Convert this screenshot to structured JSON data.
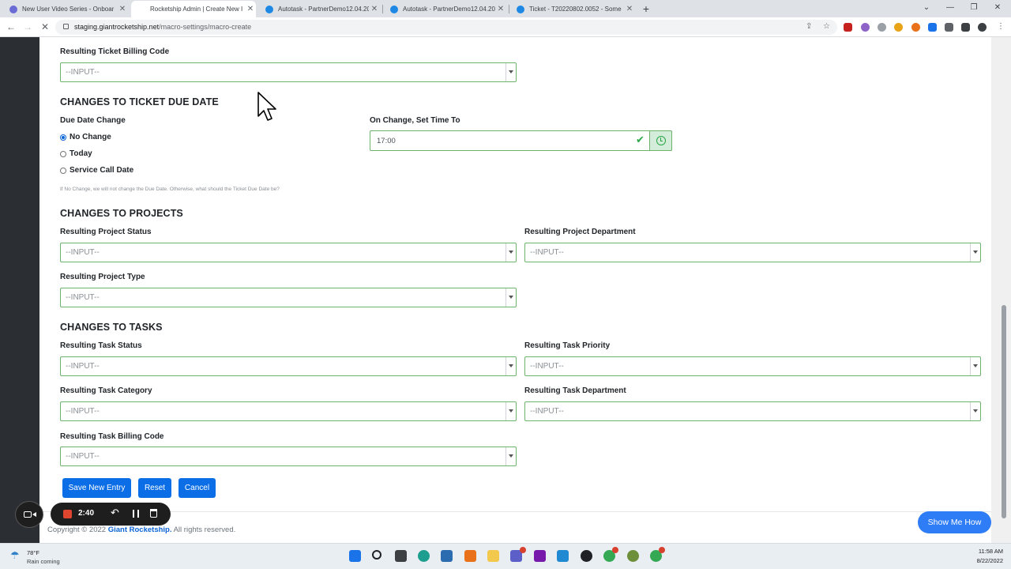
{
  "browser": {
    "tabs": [
      {
        "title": "New User Video Series - Onboar",
        "icon_color": "#6b6bd6"
      },
      {
        "title": "Rocketship Admin | Create New I",
        "icon_color": "#ffffff"
      },
      {
        "title": "Autotask - PartnerDemo12.04.20",
        "icon_color": "#1e88e5"
      },
      {
        "title": "Autotask - PartnerDemo12.04.20",
        "icon_color": "#1e88e5"
      },
      {
        "title": "Ticket - T20220802.0052 - Some",
        "icon_color": "#1e88e5"
      }
    ],
    "url_domain": "staging.giantrocketship.net",
    "url_path": "/macro-settings/macro-create"
  },
  "form": {
    "billing_code_label": "Resulting Ticket Billing Code",
    "placeholder": "--INPUT--",
    "due_date_section": "CHANGES TO TICKET DUE DATE",
    "due_date_change_label": "Due Date Change",
    "radio_options": [
      "No Change",
      "Today",
      "Service Call Date"
    ],
    "selected_radio": "No Change",
    "set_time_label": "On Change, Set Time To",
    "time_value": "17:00",
    "due_date_help": "If No Change, we will not change the Due Date. Otherwise, what should the Ticket Due Date be?",
    "projects_section": "CHANGES TO PROJECTS",
    "project_status_label": "Resulting Project Status",
    "project_department_label": "Resulting Project Department",
    "project_type_label": "Resulting Project Type",
    "tasks_section": "CHANGES TO TASKS",
    "task_status_label": "Resulting Task Status",
    "task_priority_label": "Resulting Task Priority",
    "task_category_label": "Resulting Task Category",
    "task_department_label": "Resulting Task Department",
    "task_billing_label": "Resulting Task Billing Code",
    "save_label": "Save New Entry",
    "reset_label": "Reset",
    "cancel_label": "Cancel"
  },
  "footer": {
    "prefix": "Copyright © 2022 ",
    "brand": "Giant Rocketship.",
    "suffix": " All rights reserved."
  },
  "show_me_label": "Show Me How",
  "recorder": {
    "time": "2:40"
  },
  "taskbar": {
    "temperature": "78°F",
    "weather": "Rain coming",
    "time": "11:58 AM",
    "date": "8/22/2022"
  },
  "colors": {
    "primary_button": "#0b6ee6",
    "valid_border": "#6cb46c",
    "show_me": "#2e7cf6"
  }
}
